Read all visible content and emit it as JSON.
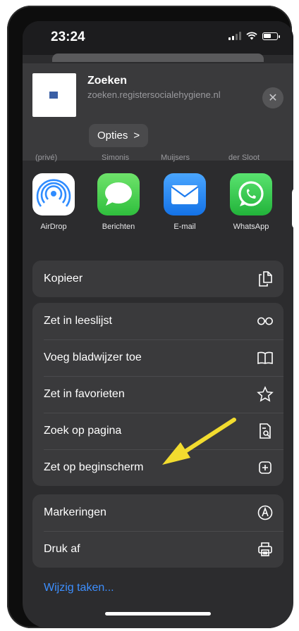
{
  "status": {
    "time": "23:24"
  },
  "header": {
    "title": "Zoeken",
    "url": "zoeken.registersocialehygiene.nl",
    "options_label": "Opties",
    "options_chevron": ">",
    "close_glyph": "✕"
  },
  "contacts_cutoff": [
    "(privé)",
    "Simonis",
    "Muijsers",
    "der Sloot"
  ],
  "apps": [
    {
      "label": "AirDrop",
      "icon": "airdrop-icon"
    },
    {
      "label": "Berichten",
      "icon": "messages-icon"
    },
    {
      "label": "E-mail",
      "icon": "mail-icon"
    },
    {
      "label": "WhatsApp",
      "icon": "whatsapp-icon"
    }
  ],
  "actions": {
    "group1": [
      {
        "label": "Kopieer",
        "icon": "copy-icon"
      }
    ],
    "group2": [
      {
        "label": "Zet in leeslijst",
        "icon": "glasses-icon"
      },
      {
        "label": "Voeg bladwijzer toe",
        "icon": "book-icon"
      },
      {
        "label": "Zet in favorieten",
        "icon": "star-icon"
      },
      {
        "label": "Zoek op pagina",
        "icon": "find-on-page-icon"
      },
      {
        "label": "Zet op beginscherm",
        "icon": "add-square-icon"
      }
    ],
    "group3": [
      {
        "label": "Markeringen",
        "icon": "markup-icon"
      },
      {
        "label": "Druk af",
        "icon": "print-icon"
      }
    ]
  },
  "edit_actions_label": "Wijzig taken...",
  "colors": {
    "sheet": "#2c2c2e",
    "row": "#3a3a3c",
    "link": "#3d8fff",
    "annotation_arrow": "#f2dc2f"
  }
}
